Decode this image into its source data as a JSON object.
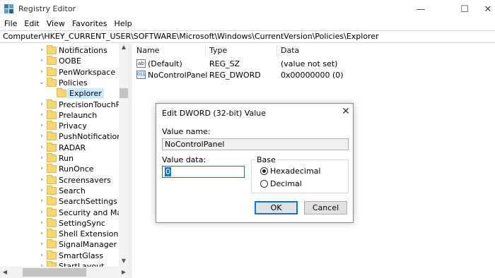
{
  "window": {
    "title": "Registry Editor",
    "minimize_glyph": "—",
    "maximize_glyph": "☐",
    "close_glyph": "✕"
  },
  "menu": [
    "File",
    "Edit",
    "View",
    "Favorites",
    "Help"
  ],
  "address": "Computer\\HKEY_CURRENT_USER\\SOFTWARE\\Microsoft\\Windows\\CurrentVersion\\Policies\\Explorer",
  "tree": {
    "items": [
      {
        "label": "Notifications",
        "selected": false
      },
      {
        "label": "OOBE",
        "selected": false
      },
      {
        "label": "PenWorkspace",
        "selected": false
      },
      {
        "label": "Policies",
        "selected": false,
        "expanded": true
      },
      {
        "label": "Explorer",
        "selected": true
      },
      {
        "label": "PrecisionTouchPad",
        "selected": false
      },
      {
        "label": "Prelaunch",
        "selected": false
      },
      {
        "label": "Privacy",
        "selected": false
      },
      {
        "label": "PushNotifications",
        "selected": false
      },
      {
        "label": "RADAR",
        "selected": false
      },
      {
        "label": "Run",
        "selected": false
      },
      {
        "label": "RunOnce",
        "selected": false
      },
      {
        "label": "Screensavers",
        "selected": false
      },
      {
        "label": "Search",
        "selected": false
      },
      {
        "label": "SearchSettings",
        "selected": false
      },
      {
        "label": "Security and Maint",
        "selected": false
      },
      {
        "label": "SettingSync",
        "selected": false
      },
      {
        "label": "Shell Extensions",
        "selected": false
      },
      {
        "label": "SignalManager",
        "selected": false
      },
      {
        "label": "SmartGlass",
        "selected": false
      },
      {
        "label": "StartLayout",
        "selected": false
      }
    ]
  },
  "values": {
    "columns": [
      "Name",
      "Type",
      "Data"
    ],
    "rows": [
      {
        "name": "(Default)",
        "type": "REG_SZ",
        "data": "(value not set)",
        "icon": "string-value-icon",
        "icon_text": "ab"
      },
      {
        "name": "NoControlPanel",
        "type": "REG_DWORD",
        "data": "0x00000000 (0)",
        "icon": "binary-value-icon",
        "icon_text": "011"
      }
    ]
  },
  "dialog": {
    "title": "Edit DWORD (32-bit) Value",
    "value_name_label": "Value name:",
    "value_name": "NoControlPanel",
    "value_data_label": "Value data:",
    "value_data": "0",
    "base_label": "Base",
    "base_options": [
      {
        "label": "Hexadecimal",
        "selected": true
      },
      {
        "label": "Decimal",
        "selected": false
      }
    ],
    "ok_label": "OK",
    "cancel_label": "Cancel"
  },
  "colors": {
    "selection": "#cce8ff",
    "accent": "#0078d7",
    "folder": "#f7d774"
  }
}
